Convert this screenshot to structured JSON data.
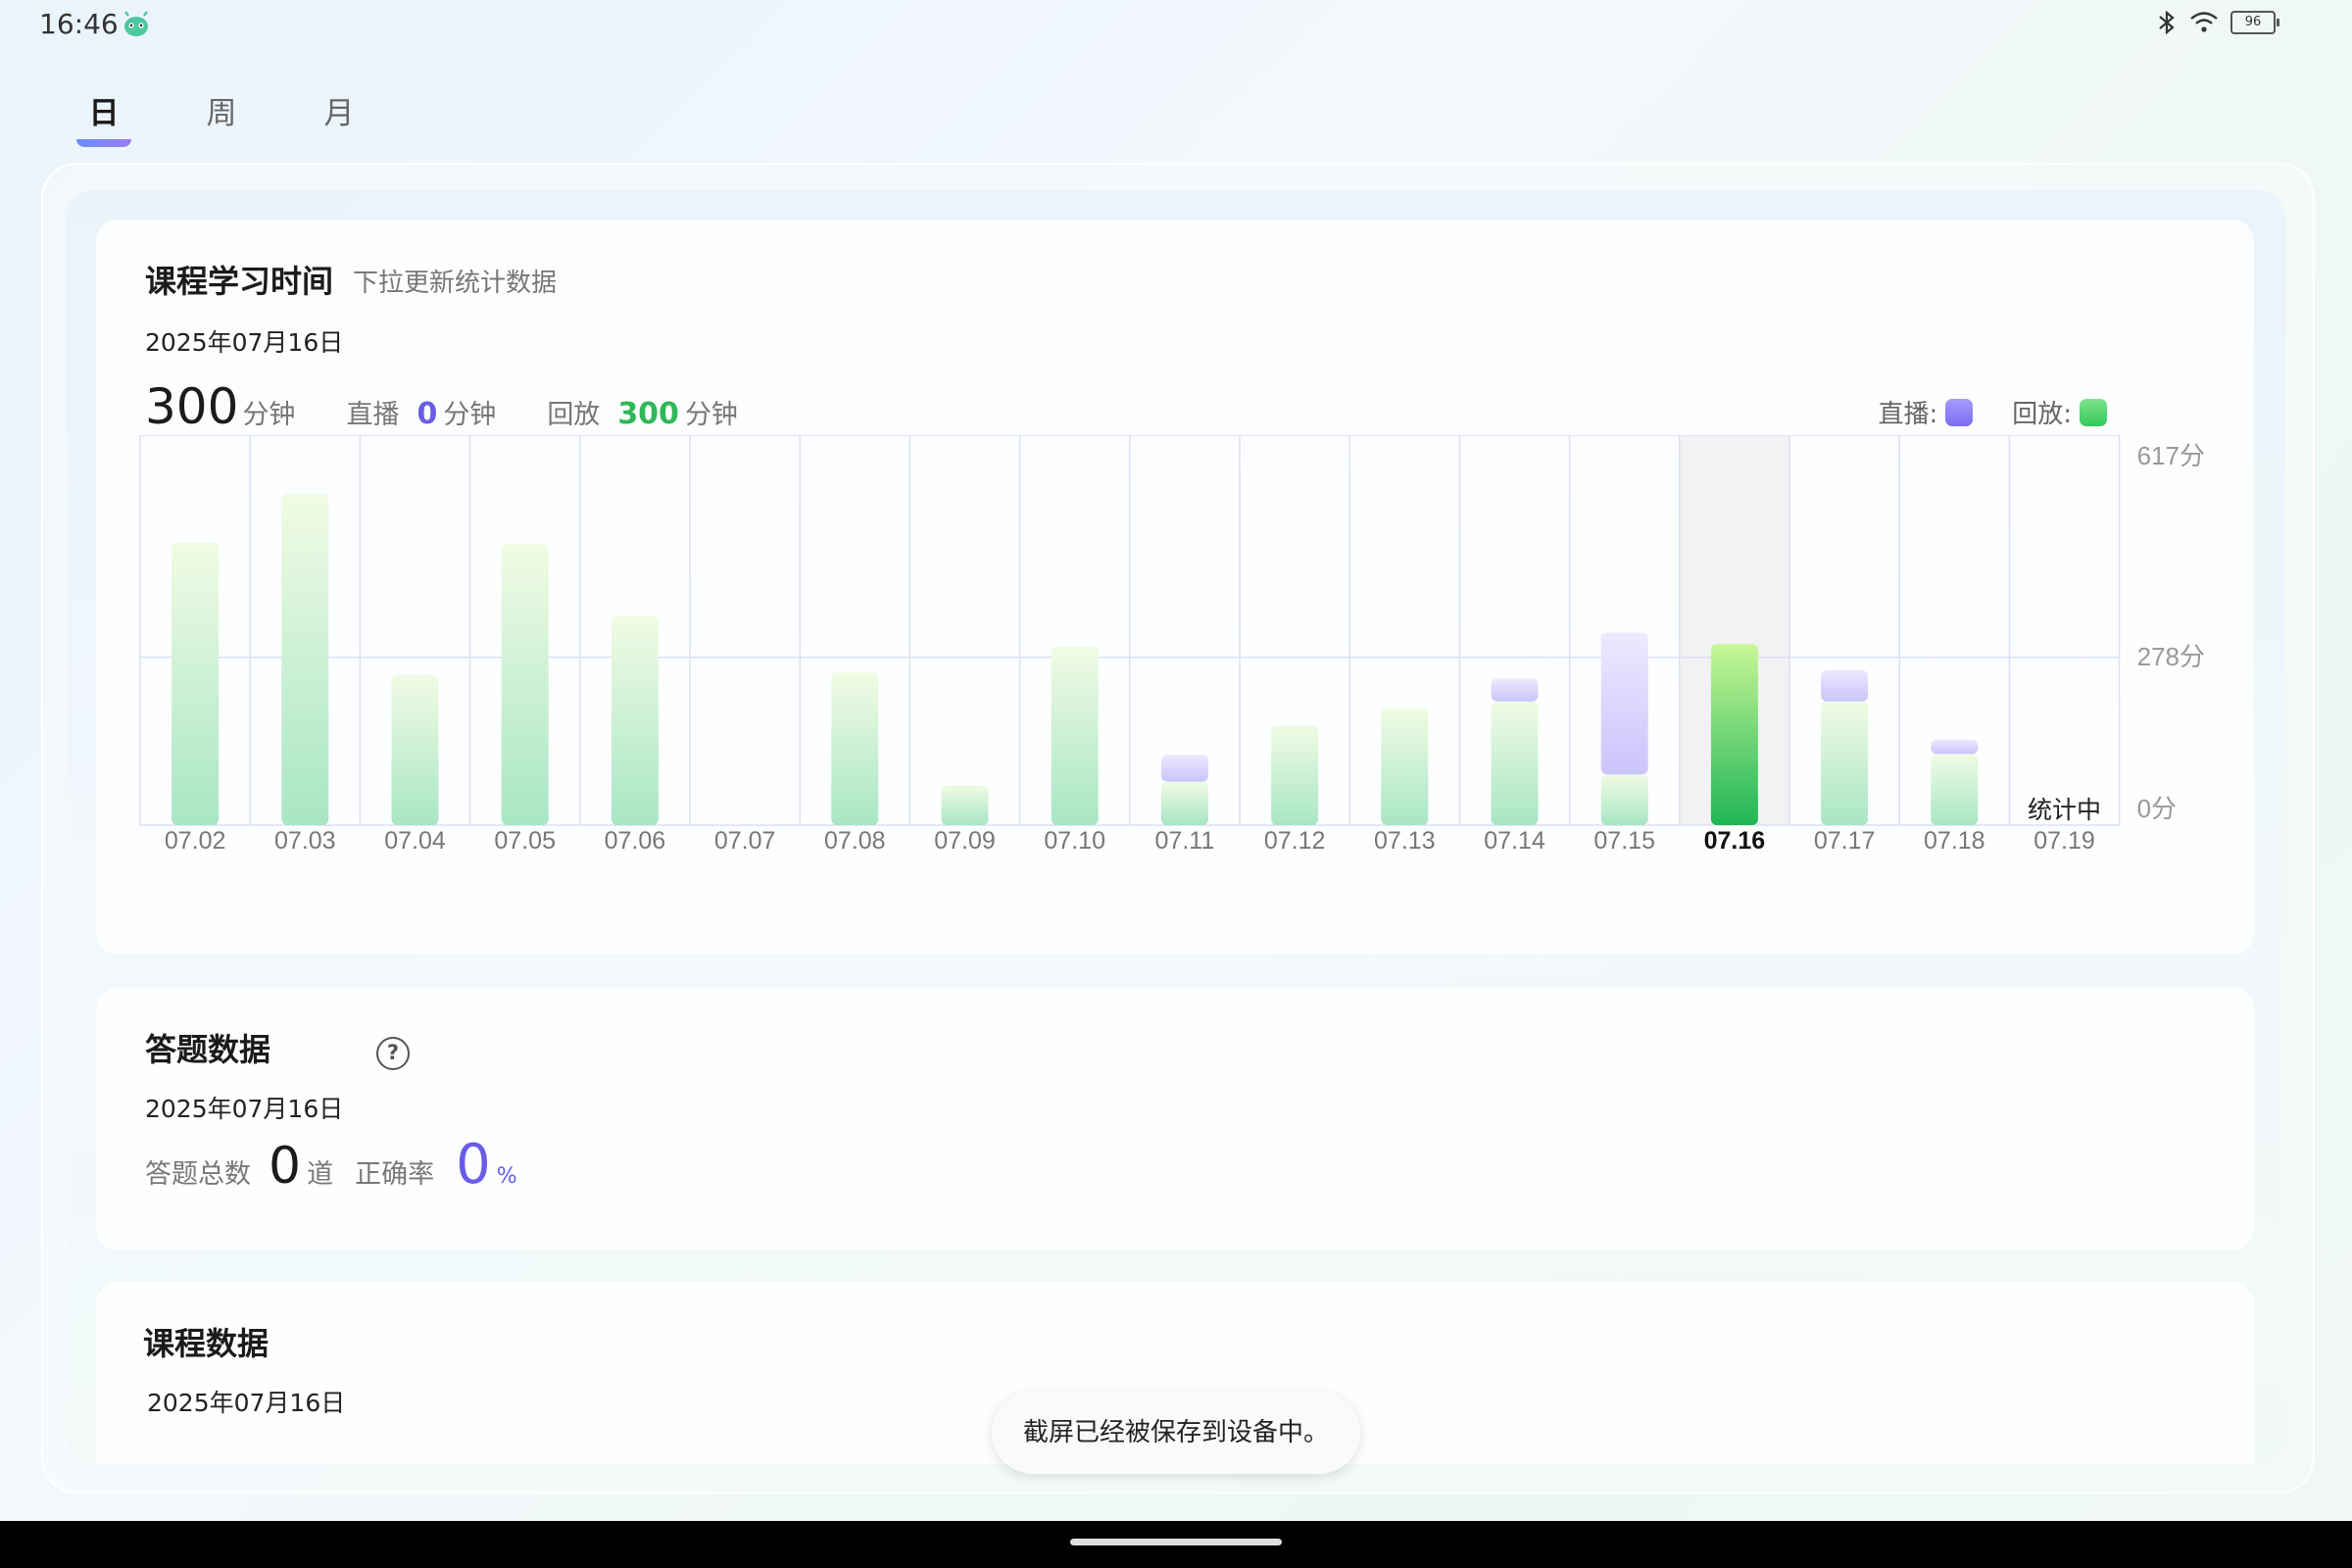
{
  "status_bar": {
    "time": "16:46",
    "app_icon": "android-robot-icon",
    "battery": "96",
    "icons": [
      "bluetooth-icon",
      "wifi-icon",
      "battery-icon"
    ]
  },
  "tabs": [
    {
      "label": "日",
      "active": true
    },
    {
      "label": "周",
      "active": false
    },
    {
      "label": "月",
      "active": false
    }
  ],
  "study_time": {
    "title": "课程学习时间",
    "subtitle": "下拉更新统计数据",
    "date": "2025年07月16日",
    "total": "300",
    "total_unit": "分钟",
    "live_label": "直播",
    "live_value": "0",
    "live_unit": "分钟",
    "replay_label": "回放",
    "replay_value": "300",
    "replay_unit": "分钟",
    "legend_live": "直播:",
    "legend_replay": "回放:",
    "colors": {
      "live": "#8b7cf6",
      "replay": "#3ccf5a"
    }
  },
  "chart_data": {
    "type": "bar",
    "stacked": true,
    "categories": [
      "07.02",
      "07.03",
      "07.04",
      "07.05",
      "07.06",
      "07.07",
      "07.08",
      "07.09",
      "07.10",
      "07.11",
      "07.12",
      "07.13",
      "07.14",
      "07.15",
      "07.16",
      "07.17",
      "07.18",
      "07.19"
    ],
    "series": [
      {
        "name": "回放",
        "values": [
          468,
          549,
          249,
          466,
          347,
          0,
          253,
          66,
          296,
          72,
          165,
          194,
          205,
          84,
          300,
          205,
          118,
          0
        ]
      },
      {
        "name": "直播",
        "values": [
          0,
          0,
          0,
          0,
          0,
          0,
          0,
          0,
          0,
          45,
          0,
          0,
          38,
          235,
          0,
          52,
          24,
          0
        ]
      }
    ],
    "y_ticks": [
      "617分",
      "278分",
      "0分"
    ],
    "ylim": [
      0,
      617
    ],
    "selected": "07.16",
    "pending_label": "统计中"
  },
  "quiz": {
    "title": "答题数据",
    "date": "2025年07月16日",
    "total_label": "答题总数",
    "total_value": "0",
    "total_unit": "道",
    "accuracy_label": "正确率",
    "accuracy_value": "0",
    "accuracy_unit": "%"
  },
  "course": {
    "title": "课程数据",
    "date": "2025年07月16日"
  },
  "toast": "截屏已经被保存到设备中。"
}
